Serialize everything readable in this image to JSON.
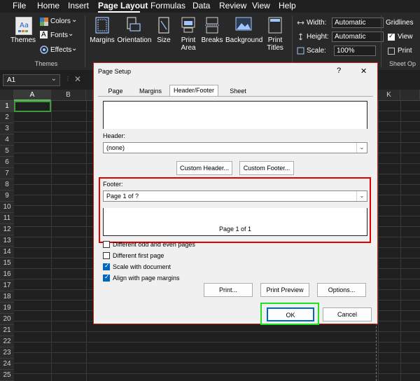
{
  "menu": {
    "items": [
      "File",
      "Home",
      "Insert",
      "Page Layout",
      "Formulas",
      "Data",
      "Review",
      "View",
      "Help"
    ],
    "active": "Page Layout"
  },
  "ribbon": {
    "themes": {
      "themes_label": "Themes",
      "colors_label": "Colors",
      "fonts_label": "Fonts",
      "effects_label": "Effects",
      "group_label": "Themes"
    },
    "page_setup": {
      "margins": "Margins",
      "orientation": "Orientation",
      "size": "Size",
      "print_area": "Print Area",
      "breaks": "Breaks",
      "background": "Background",
      "print_titles": "Print Titles"
    },
    "scale": {
      "width_label": "Width:",
      "width_value": "Automatic",
      "height_label": "Height:",
      "height_value": "Automatic",
      "scale_label": "Scale:",
      "scale_value": "100%"
    },
    "sheet_options": {
      "gridlines": "Gridlines",
      "view": "View",
      "print": "Print",
      "group_label": "Sheet Op"
    }
  },
  "formula_bar": {
    "name_box": "A1"
  },
  "sheet": {
    "columns": [
      "A",
      "B",
      "K"
    ],
    "rows": [
      "1",
      "2",
      "3",
      "4",
      "5",
      "6",
      "7",
      "8",
      "9",
      "10",
      "11",
      "12",
      "13",
      "14",
      "15",
      "16",
      "17",
      "18",
      "19",
      "20",
      "21",
      "22",
      "23",
      "24",
      "25"
    ],
    "selected_cell": "A1"
  },
  "dialog": {
    "title": "Page Setup",
    "help": "?",
    "close": "✕",
    "tabs": [
      "Page",
      "Margins",
      "Header/Footer",
      "Sheet"
    ],
    "active_tab": "Header/Footer",
    "header_label": "Header:",
    "header_value": "(none)",
    "custom_header": "Custom Header...",
    "custom_footer": "Custom Footer...",
    "footer_label": "Footer:",
    "footer_value": "Page 1 of ?",
    "footer_preview": "Page 1 of 1",
    "options": [
      {
        "label": "Different odd and even pages",
        "checked": false
      },
      {
        "label": "Different first page",
        "checked": false
      },
      {
        "label": "Scale with document",
        "checked": true
      },
      {
        "label": "Align with page margins",
        "checked": true
      }
    ],
    "print_btn": "Print...",
    "print_preview_btn": "Print Preview",
    "options_btn": "Options...",
    "ok_btn": "OK",
    "cancel_btn": "Cancel"
  },
  "colors": {
    "accent": "#0067c0",
    "footer_highlight": "#e00000",
    "ok_highlight": "#22e022",
    "dialog_border": "#c42b1c"
  }
}
